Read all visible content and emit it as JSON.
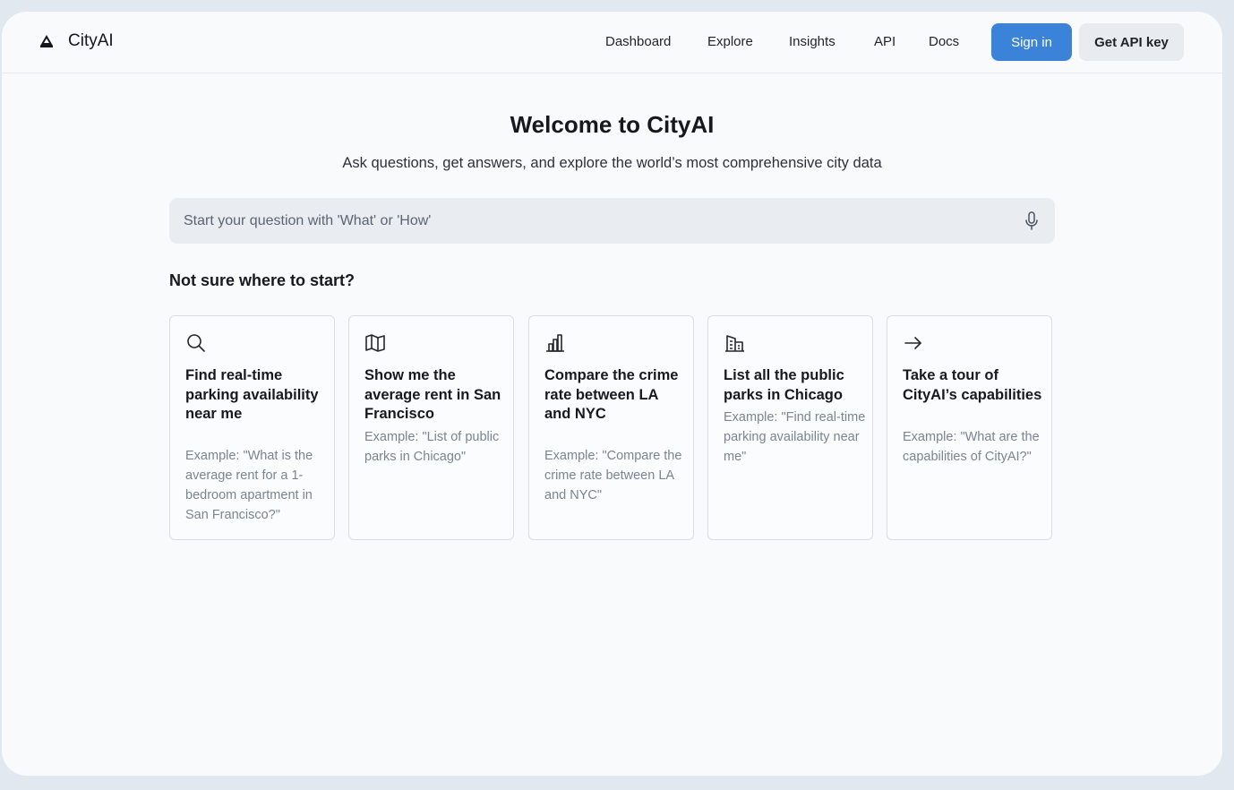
{
  "header": {
    "brand": "CityAI",
    "nav": [
      "Dashboard",
      "Explore",
      "Insights",
      "API",
      "Docs"
    ],
    "signin_label": "Sign in",
    "api_key_label": "Get API key"
  },
  "hero": {
    "title": "Welcome to CityAI",
    "subtitle": "Ask questions, get answers, and explore the world’s most comprehensive city data",
    "search_placeholder": "Start your question with 'What' or 'How'"
  },
  "suggestions": {
    "heading": "Not sure where to start?",
    "cards": [
      {
        "icon": "search-icon",
        "title": "Find real-time parking availability near me",
        "example": "Example: \"What is the average rent for a 1-bedroom apartment in San Francisco?\""
      },
      {
        "icon": "map-icon",
        "title": "Show me the average rent in San Francisco",
        "example": "Example: \"List of public parks in Chicago\""
      },
      {
        "icon": "bar-chart-icon",
        "title": "Compare the crime rate between LA and NYC",
        "example": "Example: \"Compare the crime rate between LA and NYC\""
      },
      {
        "icon": "building-icon",
        "title": "List all the public parks in Chicago",
        "example": "Example: \"Find real-time parking availability near me\""
      },
      {
        "icon": "arrow-right-icon",
        "title": "Take a tour of CityAI’s capabilities",
        "example": "Example: \"What are the capabilities of CityAI?\""
      }
    ]
  },
  "colors": {
    "accent": "#3b82d9",
    "page_bg": "#e2e8f0",
    "window_bg": "#f8fafc"
  }
}
